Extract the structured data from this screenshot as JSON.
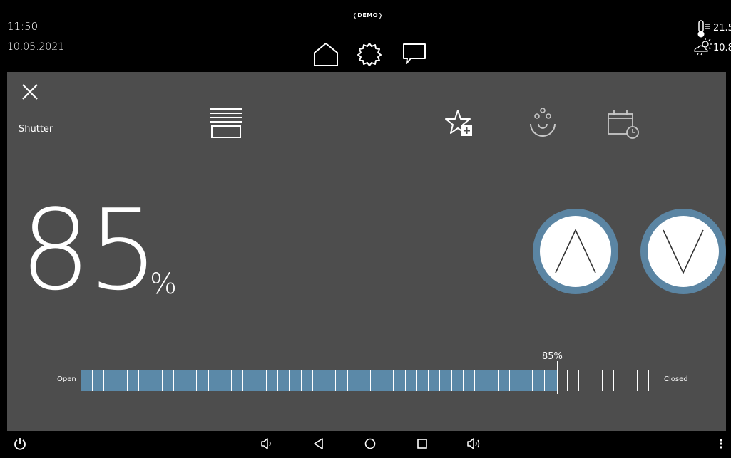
{
  "status_bar": {
    "time": "11:50",
    "date": "10.05.2021",
    "demo_label": "DEMO",
    "temp_inside": "21.5°",
    "temp_outside": "10.8°"
  },
  "top_nav": {
    "icons": [
      "home-icon",
      "gear-icon",
      "chat-icon"
    ]
  },
  "device": {
    "name": "Shutter",
    "value": "85",
    "unit": "%",
    "position_percent": 85,
    "position_label": "85%",
    "open_label": "Open",
    "closed_label": "Closed"
  },
  "actions": {
    "icons": [
      "shutter-icon",
      "favorite-add-icon",
      "scene-icon",
      "schedule-icon"
    ]
  },
  "colors": {
    "accent": "#5b85a3",
    "fill": "#5b89a8",
    "panel": "#4d4d4d",
    "background": "#000000"
  },
  "android_nav": {
    "icons": [
      "power-icon",
      "volume-down-icon",
      "back-icon",
      "home-circle-icon",
      "recents-icon",
      "volume-up-icon",
      "more-icon"
    ]
  }
}
